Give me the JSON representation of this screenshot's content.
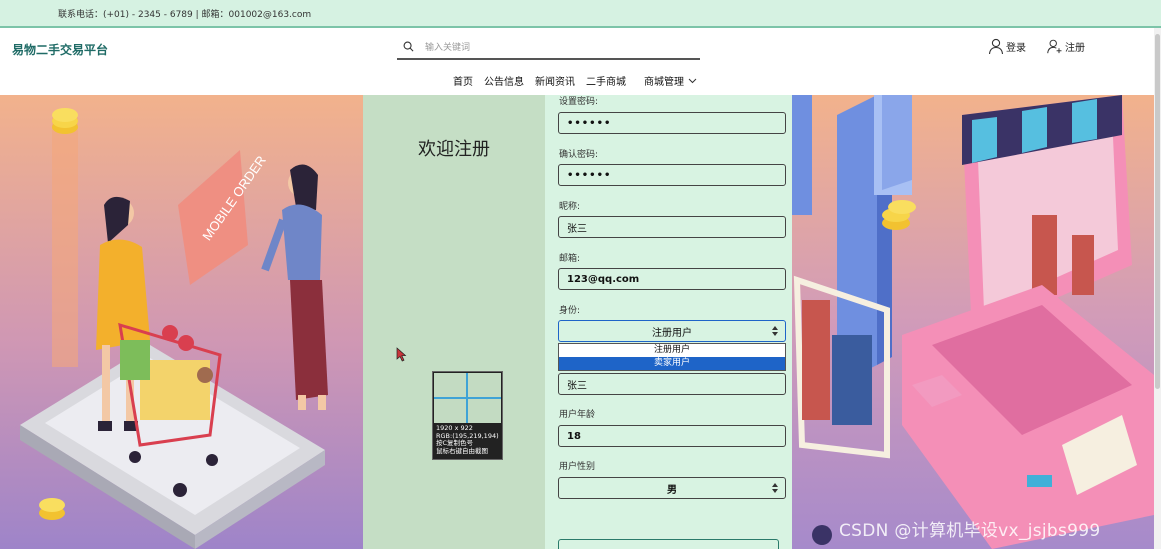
{
  "topbar": {
    "contact": "联系电话：(+01) - 2345 - 6789 | 邮箱：001002@163.com"
  },
  "header": {
    "brand": "易物二手交易平台",
    "search_placeholder": "输入关键词",
    "login_label": "登录",
    "register_label": "注册",
    "nav": {
      "home": "首页",
      "notice": "公告信息",
      "news": "新闻资讯",
      "market": "二手商城",
      "manage": "商城管理"
    }
  },
  "panel": {
    "welcome": "欢迎注册"
  },
  "form": {
    "set_password_label": "设置密码:",
    "set_password_value": "••••••",
    "confirm_password_label": "确认密码:",
    "confirm_password_value": "••••••",
    "nickname_label": "昵称:",
    "nickname_value": "张三",
    "email_label": "邮箱:",
    "email_value": "123@qq.com",
    "role_label": "身份:",
    "role_value": "注册用户",
    "role_options": [
      "注册用户",
      "卖家用户"
    ],
    "name_value": "张三",
    "age_label": "用户年龄",
    "age_value": "18",
    "gender_label": "用户性别",
    "gender_value": "男"
  },
  "screenshot_tool": {
    "line1": "1920 x 922",
    "line2": "RGB:(195,219,194)",
    "line3": "按C复制色号",
    "line4": "鼠标右键自由截图"
  },
  "watermark": "CSDN @计算机毕设vx_jsjbs999",
  "illustration": {
    "sign_text": "MOBILE ORDER"
  },
  "colors": {
    "brand": "#1f6b66",
    "topbar_bg": "#d6f2e2",
    "form_bg": "#d8f3e2",
    "mid_panel_bg": "#c5dec5",
    "selected_option": "#1e64c8"
  }
}
